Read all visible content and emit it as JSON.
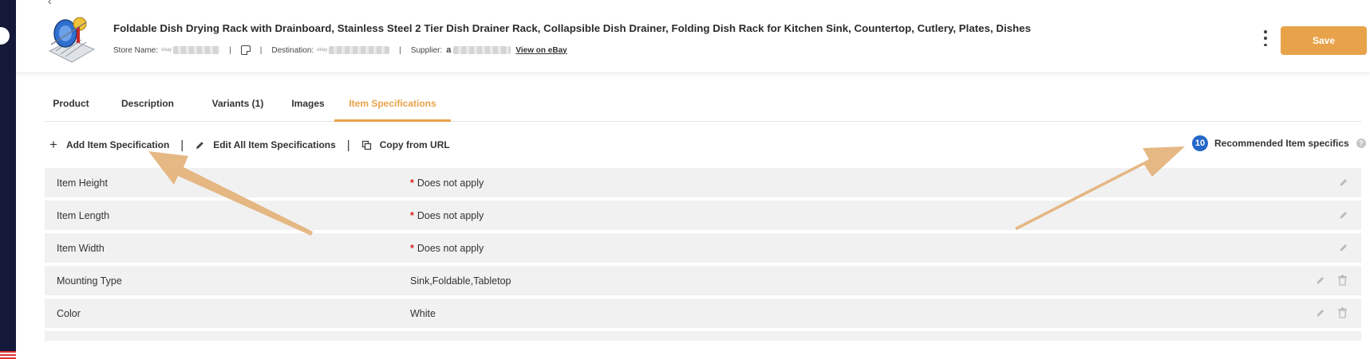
{
  "product": {
    "title": "Foldable Dish Drying Rack with Drainboard, Stainless Steel 2 Tier Dish Drainer Rack, Collapsible Dish Drainer, Folding Dish Rack for Kitchen Sink, Countertop, Cutlery, Plates, Dishes",
    "store_label": "Store Name:",
    "ebay_mini": "ebay",
    "destination_label": "Destination:",
    "destination_mini": "ebay",
    "supplier_label": "Supplier:",
    "supplier_logo": "a",
    "view_link": "View on eBay"
  },
  "header": {
    "save_label": "Save"
  },
  "tabs": [
    {
      "label": "Product"
    },
    {
      "label": "Description"
    },
    {
      "label": "Variants (1)"
    },
    {
      "label": "Images"
    },
    {
      "label": "Item Specifications",
      "active": true
    }
  ],
  "actions": {
    "add_label": "Add Item Specification",
    "edit_all_label": "Edit All Item Specifications",
    "copy_label": "Copy from URL"
  },
  "recommended": {
    "count": "10",
    "label": "Recommended Item specifics",
    "help": "?"
  },
  "specs": [
    {
      "name": "Item Height",
      "value": "Does not apply",
      "required": true,
      "deletable": false
    },
    {
      "name": "Item Length",
      "value": "Does not apply",
      "required": true,
      "deletable": false
    },
    {
      "name": "Item Width",
      "value": "Does not apply",
      "required": true,
      "deletable": false
    },
    {
      "name": "Mounting Type",
      "value": "Sink,Foldable,Tabletop",
      "required": false,
      "deletable": true
    },
    {
      "name": "Color",
      "value": "White",
      "required": false,
      "deletable": true
    }
  ],
  "colors": {
    "accent": "#e8a34a",
    "badge": "#2567c9",
    "required": "#dd2222",
    "sidebar": "#14193a",
    "annotation_arrow": "#e3b27a"
  },
  "icons": [
    "kebab-menu-icon",
    "note-icon",
    "plus-icon",
    "pencil-icon",
    "copy-icon",
    "help-icon",
    "edit-icon",
    "trash-icon"
  ]
}
